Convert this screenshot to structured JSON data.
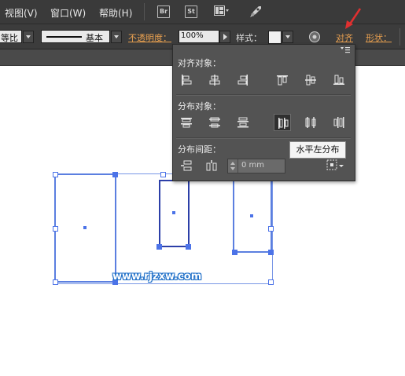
{
  "menubar": {
    "items": [
      "视图(V)",
      "窗口(W)",
      "帮助(H)"
    ],
    "apps": [
      "Br",
      "St"
    ]
  },
  "control": {
    "profile_value": "等比",
    "stroke_value": "基本",
    "opacity_label": "不透明度：",
    "opacity_value": "100%",
    "style_label": "样式：",
    "align_label": "对齐",
    "shape_label": "形状："
  },
  "align_panel": {
    "align_objects_title": "对齐对象：",
    "align_objects_icons": [
      "horizontal-align-left-icon",
      "horizontal-align-center-icon",
      "horizontal-align-right-icon",
      "vertical-align-top-icon",
      "vertical-align-center-icon",
      "vertical-align-bottom-icon"
    ],
    "distribute_objects_title": "分布对象：",
    "distribute_objects_icons": [
      "vertical-distribute-top-icon",
      "vertical-distribute-center-icon",
      "vertical-distribute-bottom-icon",
      "horizontal-distribute-left-icon",
      "horizontal-distribute-center-icon",
      "horizontal-distribute-right-icon"
    ],
    "distribute_spacing_title": "分布间距：",
    "spacing_value": "0 mm",
    "tooltip": "水平左分布"
  },
  "canvas": {
    "watermark": "www.rjzxw.com"
  },
  "colors": {
    "selection_blue": "#4c73e8",
    "accent_orange": "#e8a050",
    "annotation_red": "#e03030"
  }
}
